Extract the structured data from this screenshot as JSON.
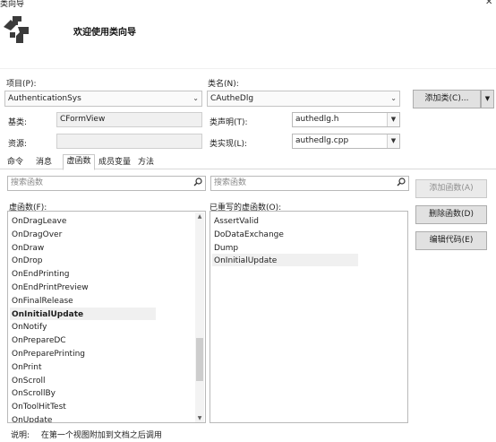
{
  "window": {
    "title": "类向导",
    "close_glyph": "✕"
  },
  "header": {
    "title": "欢迎使用类向导",
    "icon": "class-wizard-icon"
  },
  "project": {
    "label": "项目(P):",
    "value": "AuthenticationSys"
  },
  "classname": {
    "label": "类名(N):",
    "value": "CAutheDlg"
  },
  "add_class_button": {
    "label": "添加类(C)...",
    "arrow": "▼"
  },
  "base_class": {
    "label": "基类:",
    "value": "CFormView"
  },
  "resource": {
    "label": "资源:",
    "value": ""
  },
  "class_decl": {
    "label": "类声明(T):",
    "value": "authedlg.h"
  },
  "class_impl": {
    "label": "类实现(L):",
    "value": "authedlg.cpp"
  },
  "tabs": [
    {
      "label": "命令",
      "active": false
    },
    {
      "label": "消息",
      "active": false
    },
    {
      "label": "虚函数",
      "active": true
    },
    {
      "label": "成员变量",
      "active": false
    },
    {
      "label": "方法",
      "active": false
    }
  ],
  "search_left": {
    "placeholder": "搜索函数"
  },
  "search_right": {
    "placeholder": "搜索函数"
  },
  "virtual_functions": {
    "label": "虚函数(F):",
    "items": [
      "OnDragLeave",
      "OnDragOver",
      "OnDraw",
      "OnDrop",
      "OnEndPrinting",
      "OnEndPrintPreview",
      "OnFinalRelease",
      "OnInitialUpdate",
      "OnNotify",
      "OnPrepareDC",
      "OnPreparePrinting",
      "OnPrint",
      "OnScroll",
      "OnScrollBy",
      "OnToolHitTest",
      "OnUpdate"
    ],
    "selected": "OnInitialUpdate",
    "scroll_position": 0.78
  },
  "overridden_functions": {
    "label": "已重写的虚函数(O):",
    "items": [
      "AssertValid",
      "DoDataExchange",
      "Dump",
      "OnInitialUpdate"
    ],
    "selected": "OnInitialUpdate"
  },
  "buttons": {
    "add_function": "添加函数(A)",
    "delete_function": "删除函数(D)",
    "edit_code": "编辑代码(E)"
  },
  "status": {
    "label": "说明:",
    "text": "在第一个视图附加到文档之后调用"
  }
}
